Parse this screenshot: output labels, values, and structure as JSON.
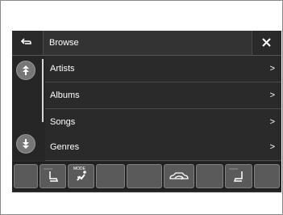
{
  "header": {
    "title": "Browse",
    "back_icon": "back-arrow-icon",
    "close_icon": "close-icon"
  },
  "list": {
    "items": [
      {
        "label": "Artists",
        "chevron": ">"
      },
      {
        "label": "Albums",
        "chevron": ">"
      },
      {
        "label": "Songs",
        "chevron": ">"
      },
      {
        "label": "Genres",
        "chevron": ">"
      }
    ],
    "scroll_up_icon": "scroll-up-icon",
    "scroll_down_icon": "scroll-down-icon"
  },
  "bottom_bar": {
    "mode_label": "MODE",
    "icons": [
      "seat-heat-left-icon",
      "fan-mode-icon",
      "recirculation-car-icon",
      "seat-heat-right-icon"
    ]
  },
  "colors": {
    "screen_bg": "#2b2b2b",
    "text": "#ffffff",
    "button": "#5a5a5a"
  }
}
